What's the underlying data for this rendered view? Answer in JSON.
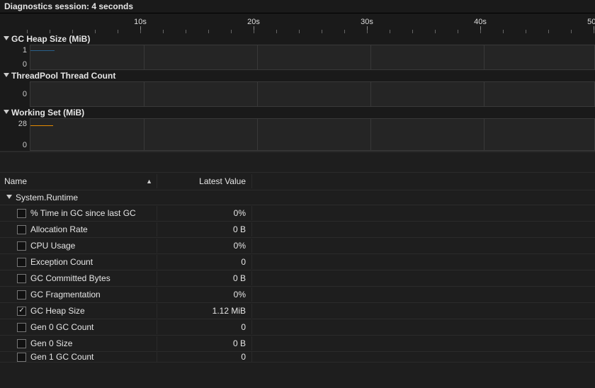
{
  "session": {
    "header": "Diagnostics session: 4 seconds"
  },
  "chart_data": [
    {
      "type": "line",
      "title": "GC Heap Size (MiB)",
      "ylabel": "MiB",
      "ylim": [
        0,
        1
      ],
      "y_ticks": [
        "1",
        "0"
      ],
      "x": [
        0,
        60
      ],
      "xticks": [
        "10s",
        "20s",
        "30s",
        "40s",
        "50s"
      ],
      "series": [
        {
          "name": "GC Heap Size",
          "values": [
            1.12
          ]
        }
      ]
    },
    {
      "type": "line",
      "title": "ThreadPool Thread Count",
      "ylabel": "Count",
      "ylim": [
        0,
        0
      ],
      "y_ticks": [
        "0"
      ],
      "x": [
        0,
        60
      ],
      "series": [
        {
          "name": "ThreadPool Thread Count",
          "values": [
            0
          ]
        }
      ]
    },
    {
      "type": "line",
      "title": "Working Set (MiB)",
      "ylabel": "MiB",
      "ylim": [
        0,
        28
      ],
      "y_ticks": [
        "28",
        "0"
      ],
      "x": [
        0,
        60
      ],
      "series": [
        {
          "name": "Working Set",
          "values": [
            28
          ]
        }
      ]
    }
  ],
  "ruler": {
    "labels": [
      "10s",
      "20s",
      "30s",
      "40s",
      "50s"
    ]
  },
  "counters": {
    "header_name": "Name",
    "header_value": "Latest Value",
    "group": "System.Runtime",
    "rows": [
      {
        "checked": false,
        "name": "% Time in GC since last GC",
        "value": "0%"
      },
      {
        "checked": false,
        "name": "Allocation Rate",
        "value": "0 B"
      },
      {
        "checked": false,
        "name": "CPU Usage",
        "value": "0%"
      },
      {
        "checked": false,
        "name": "Exception Count",
        "value": "0"
      },
      {
        "checked": false,
        "name": "GC Committed Bytes",
        "value": "0 B"
      },
      {
        "checked": false,
        "name": "GC Fragmentation",
        "value": "0%"
      },
      {
        "checked": true,
        "name": "GC Heap Size",
        "value": "1.12 MiB"
      },
      {
        "checked": false,
        "name": "Gen 0 GC Count",
        "value": "0"
      },
      {
        "checked": false,
        "name": "Gen 0 Size",
        "value": "0 B"
      },
      {
        "checked": false,
        "name": "Gen 1 GC Count",
        "value": "0"
      }
    ]
  }
}
